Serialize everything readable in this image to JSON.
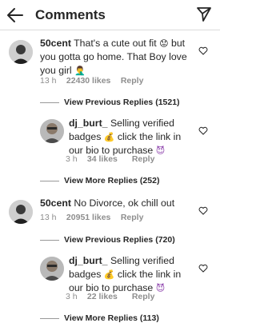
{
  "header": {
    "title": "Comments"
  },
  "comments": [
    {
      "username": "50cent",
      "text": "That's a cute out fit",
      "emoji1": "😟",
      "text2": "but you gotta go home. That Boy love you girl",
      "emoji2": "🤦‍♂️",
      "time": "13 h",
      "likes": "22430 likes",
      "reply": "Reply",
      "replies_toggle": "View Previous Replies (1521)"
    },
    {
      "username": "dj_burt_",
      "text": "Selling verified badges",
      "emoji1": "💰",
      "text2": "click the link in our bio to purchase",
      "emoji2": "😈",
      "time": "3 h",
      "likes": "34 likes",
      "reply": "Reply",
      "replies_toggle": "View More Replies (252)"
    },
    {
      "username": "50cent",
      "text": "No Divorce, ok chill out",
      "time": "13 h",
      "likes": "20951 likes",
      "reply": "Reply",
      "replies_toggle": "View Previous Replies (720)"
    },
    {
      "username": "dj_burt_",
      "text": "Selling verified badges",
      "emoji1": "💰",
      "text2": "click the link in our bio to purchase",
      "emoji2": "😈",
      "time": "3 h",
      "likes": "22 likes",
      "reply": "Reply",
      "replies_toggle": "View More Replies (113)"
    }
  ],
  "icons": {
    "back": "arrow-left-icon",
    "send": "paper-plane-icon",
    "like": "heart-outline-icon"
  },
  "colors": {
    "text": "#262626",
    "meta": "#8e8e8e",
    "purple_devil": "#8e44ad"
  }
}
